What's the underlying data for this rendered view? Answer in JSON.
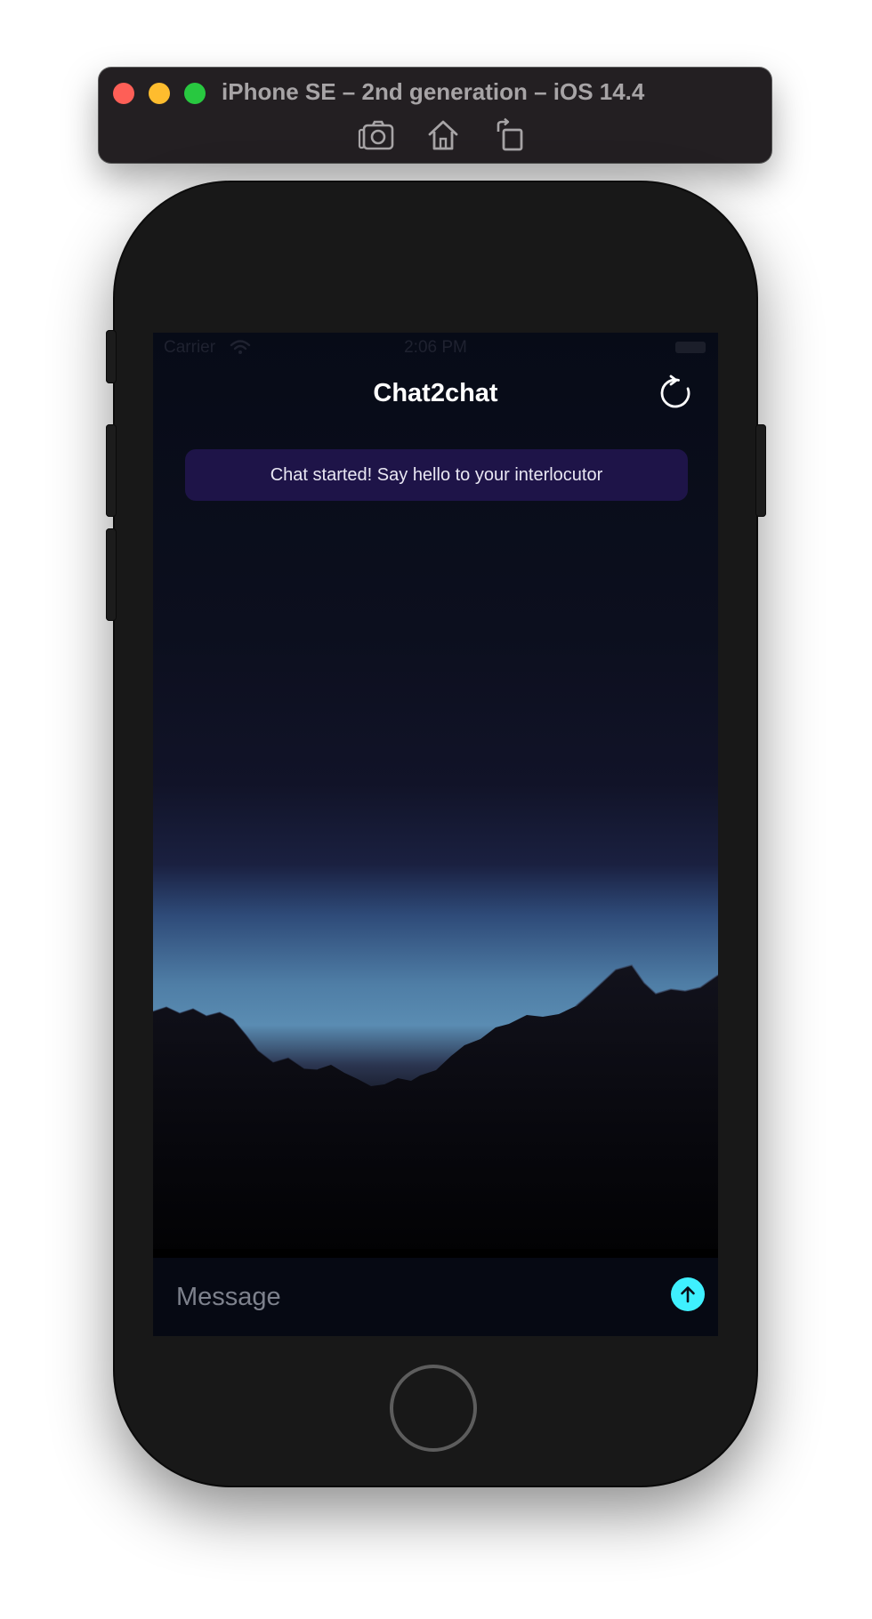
{
  "simulator": {
    "title": "iPhone SE – 2nd generation – iOS 14.4",
    "tools": [
      "screenshot-icon",
      "home-icon",
      "rotate-icon"
    ]
  },
  "status_bar": {
    "carrier": "Carrier",
    "time": "2:06 PM"
  },
  "app": {
    "title": "Chat2chat",
    "refresh_icon": "refresh-icon",
    "system_message": "Chat started! Say hello to your interlocutor"
  },
  "composer": {
    "placeholder": "Message",
    "value": "",
    "send_icon": "arrow-up-icon"
  },
  "colors": {
    "accent": "#3ff0ff",
    "banner": "#1e1448",
    "chrome": "#231f22"
  }
}
